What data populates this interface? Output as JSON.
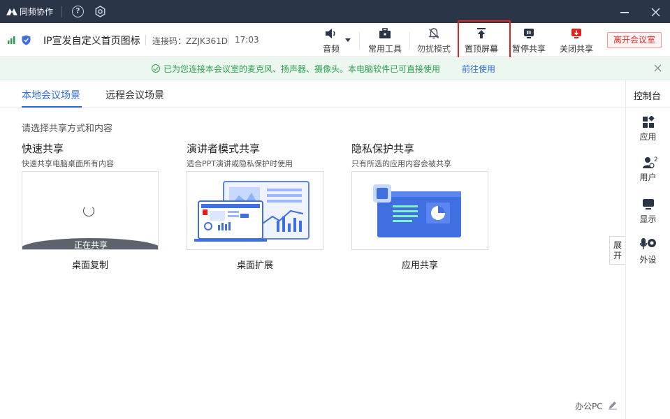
{
  "titlebar": {
    "app_name": "同频协作",
    "help_glyph": "?"
  },
  "meeting": {
    "room_name": "IP宣发自定义首页图标",
    "connection_code": "连接码：ZZJK361D",
    "time": "17:03"
  },
  "toolbar": {
    "audio": "音频",
    "common_tools": "常用工具",
    "do_not_disturb": "勿扰模式",
    "pin_screen": "置顶屏幕",
    "pause_share": "暂停共享",
    "close_share": "关闭共享",
    "leave_room": "离开会议室"
  },
  "notice": {
    "text": "已为您连接本会议室的麦克风、扬声器、摄像头。本电脑软件已可直接使用",
    "link": "前往使用"
  },
  "tabs": [
    {
      "label": "本地会议场景"
    },
    {
      "label": "远程会议场景"
    }
  ],
  "content": {
    "instruction": "请选择共享方式和内容",
    "cards": [
      {
        "title": "快速共享",
        "desc": "快速共享电脑桌面所有内容",
        "label": "桌面复制",
        "status": "正在共享"
      },
      {
        "title": "演讲者模式共享",
        "desc": "适合PPT演讲或隐私保护时使用",
        "label": "桌面扩展"
      },
      {
        "title": "隐私保护共享",
        "desc": "只有所选的应用内容会被共享",
        "label": "应用共享"
      }
    ]
  },
  "side_panel": {
    "title": "控制台",
    "items": [
      {
        "label": "应用"
      },
      {
        "label": "用户",
        "badge": "2"
      },
      {
        "label": "显示"
      },
      {
        "label": "外设"
      }
    ],
    "expand": "展开"
  },
  "footer": {
    "device": "办公PC"
  },
  "colors": {
    "titlebar": "#2b3548",
    "accent": "#2f6bd8",
    "success": "#29a24d",
    "danger": "#e0211c"
  }
}
